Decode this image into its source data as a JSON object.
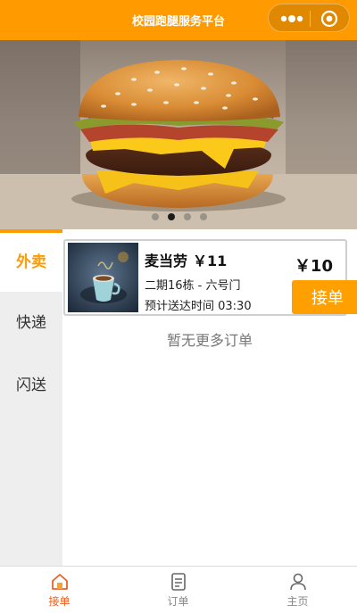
{
  "header": {
    "title": "校园跑腿服务平台",
    "background": "#FF9B00",
    "more_icon": "more-dots-icon",
    "close_icon": "target-circle-icon"
  },
  "banner": {
    "image": "burger-photo",
    "dots_count": 4,
    "active_dot": 1
  },
  "sidebar": {
    "items": [
      {
        "label": "外卖",
        "active": true
      },
      {
        "label": "快递",
        "active": false
      },
      {
        "label": "闪送",
        "active": false
      }
    ]
  },
  "orders": [
    {
      "store": "麦当劳",
      "price_inline": "￥11",
      "price_big": "￥10",
      "address": "二期16栋 - 六号门",
      "eta": "预计送达时间 03:30",
      "accept_label": "接单",
      "thumbnail": "coffee-cup-photo"
    }
  ],
  "status": {
    "no_more": "暂无更多订单"
  },
  "tabbar": {
    "items": [
      {
        "label": "接单",
        "icon": "home-icon",
        "active": true
      },
      {
        "label": "订单",
        "icon": "order-list-icon",
        "active": false
      },
      {
        "label": "主页",
        "icon": "user-icon",
        "active": false
      }
    ]
  },
  "colors": {
    "accent": "#FF9B00",
    "button": "#FFA000",
    "tab_active": "#E8632A"
  }
}
